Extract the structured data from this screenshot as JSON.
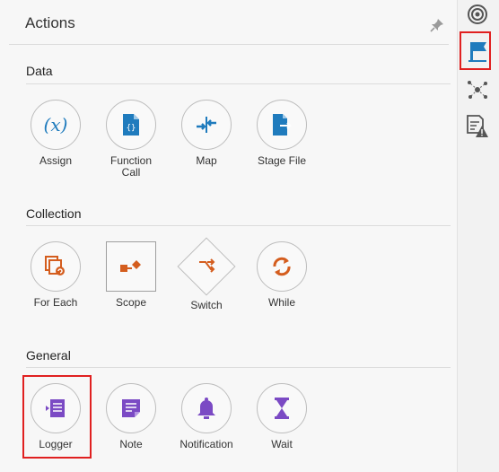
{
  "header": {
    "title": "Actions",
    "pin_icon": "pin-icon"
  },
  "sections": [
    {
      "title": "Data",
      "items": [
        {
          "label": "Assign",
          "icon": "variable-x-icon"
        },
        {
          "label": "Function Call",
          "icon": "function-file-icon"
        },
        {
          "label": "Map",
          "icon": "map-arrows-icon"
        },
        {
          "label": "Stage File",
          "icon": "stage-file-icon"
        }
      ]
    },
    {
      "title": "Collection",
      "items": [
        {
          "label": "For Each",
          "icon": "for-each-icon"
        },
        {
          "label": "Scope",
          "icon": "scope-icon"
        },
        {
          "label": "Switch",
          "icon": "switch-icon"
        },
        {
          "label": "While",
          "icon": "while-loop-icon"
        }
      ]
    },
    {
      "title": "General",
      "items": [
        {
          "label": "Logger",
          "icon": "logger-icon"
        },
        {
          "label": "Note",
          "icon": "note-icon"
        },
        {
          "label": "Notification",
          "icon": "bell-icon"
        },
        {
          "label": "Wait",
          "icon": "hourglass-icon"
        }
      ]
    }
  ],
  "rail": [
    {
      "icon": "target-icon"
    },
    {
      "icon": "flag-icon",
      "active": true
    },
    {
      "icon": "network-icon"
    },
    {
      "icon": "error-report-icon"
    }
  ],
  "colors": {
    "blue": "#1f7bbd",
    "orange": "#d45d1e",
    "purple": "#7b4ac4",
    "highlight": "#e02020"
  }
}
